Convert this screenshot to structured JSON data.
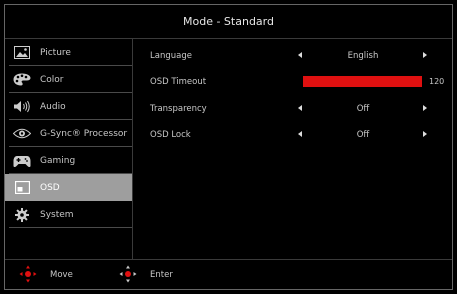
{
  "header": {
    "title": "Mode - Standard"
  },
  "sidebar": {
    "items": [
      {
        "label": "Picture",
        "icon": "picture-icon",
        "active": false
      },
      {
        "label": "Color",
        "icon": "palette-icon",
        "active": false
      },
      {
        "label": "Audio",
        "icon": "speaker-icon",
        "active": false
      },
      {
        "label": "G-Sync® Processor",
        "icon": "gsync-eye-icon",
        "active": false
      },
      {
        "label": "Gaming",
        "icon": "gamepad-icon",
        "active": false
      },
      {
        "label": "OSD",
        "icon": "osd-icon",
        "active": true
      },
      {
        "label": "System",
        "icon": "gear-icon",
        "active": false
      }
    ]
  },
  "settings": {
    "language": {
      "label": "Language",
      "value": "English"
    },
    "osd_timeout": {
      "label": "OSD Timeout",
      "value": "120",
      "fill_fraction": 1.0
    },
    "transparency": {
      "label": "Transparency",
      "value": "Off"
    },
    "osd_lock": {
      "label": "OSD Lock",
      "value": "Off"
    }
  },
  "footer": {
    "move_label": "Move",
    "enter_label": "Enter"
  },
  "colors": {
    "accent_red": "#e01010",
    "active_bg": "#9e9e9e",
    "background": "#000000"
  }
}
